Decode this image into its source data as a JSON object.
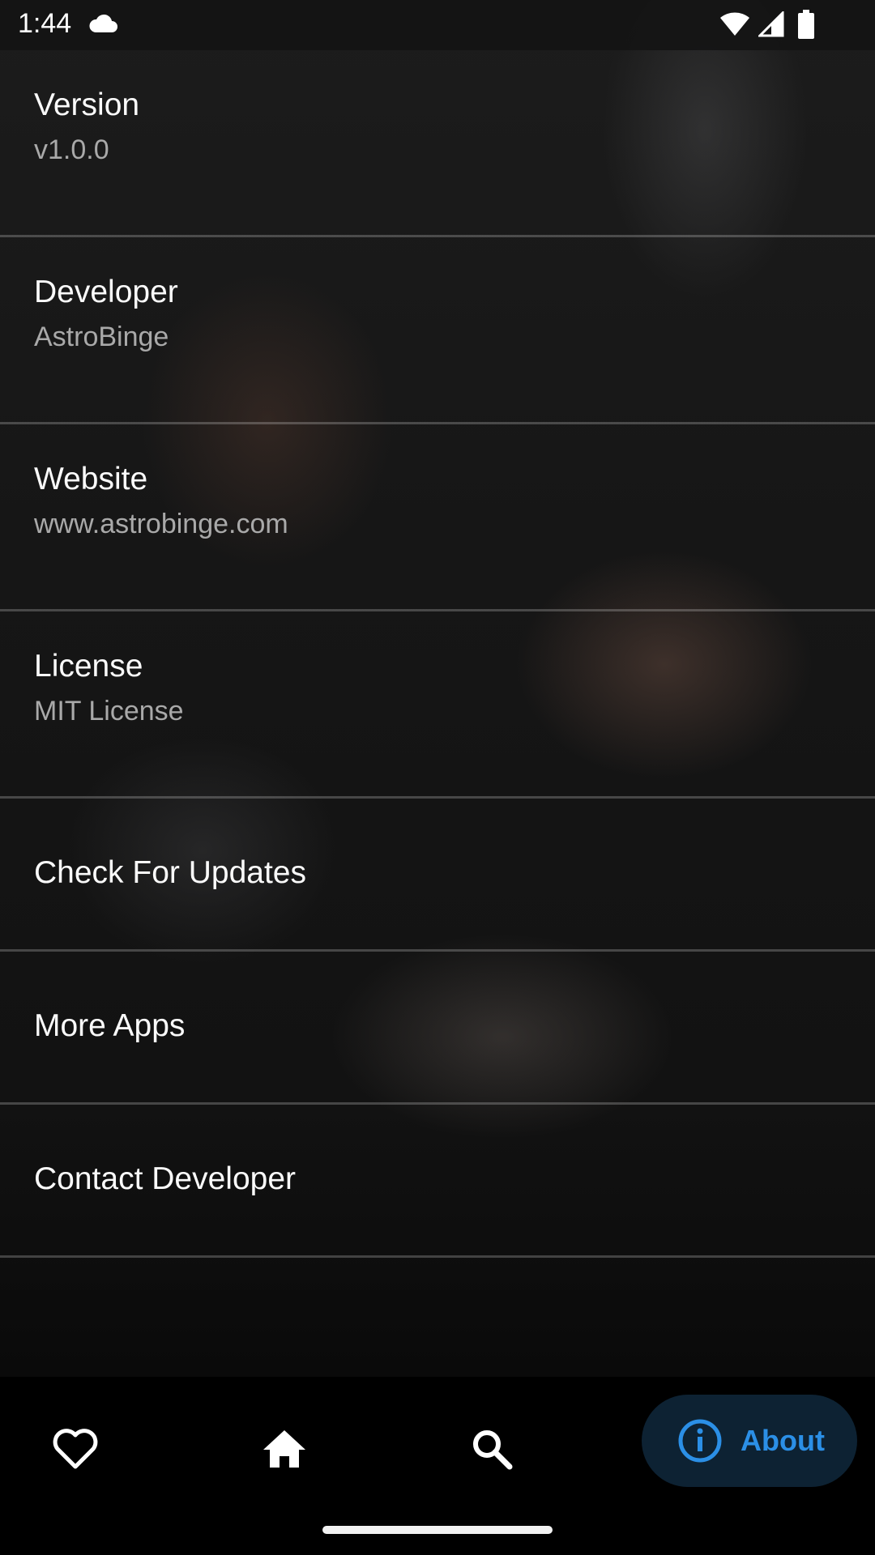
{
  "status_bar": {
    "time": "1:44",
    "icons": [
      "cloud-icon",
      "wifi-icon",
      "signal-icon",
      "battery-icon"
    ]
  },
  "settings": {
    "version": {
      "title": "Version",
      "value": "v1.0.0"
    },
    "developer": {
      "title": "Developer",
      "value": "AstroBinge"
    },
    "website": {
      "title": "Website",
      "value": "www.astrobinge.com"
    },
    "license": {
      "title": "License",
      "value": "MIT License"
    },
    "check_updates": {
      "title": "Check For Updates"
    },
    "more_apps": {
      "title": "More Apps"
    },
    "contact_developer": {
      "title": "Contact Developer"
    }
  },
  "bottom_nav": {
    "items": [
      {
        "icon": "heart-icon"
      },
      {
        "icon": "home-icon"
      },
      {
        "icon": "search-icon"
      },
      {
        "icon": "info-icon",
        "label": "About",
        "selected": true
      }
    ],
    "accent_color": "#2b8fe6",
    "selected_bg": "#0d2233"
  }
}
